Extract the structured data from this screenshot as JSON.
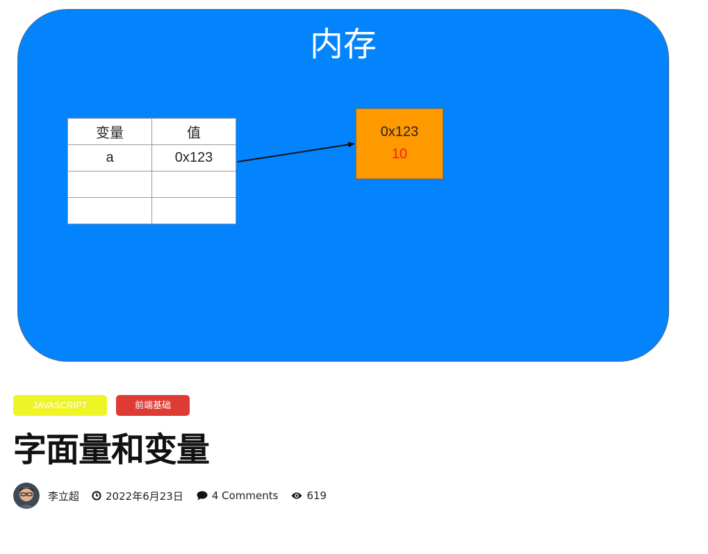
{
  "diagram": {
    "title": "内存",
    "table": {
      "headers": [
        "变量",
        "值"
      ],
      "rows": [
        [
          "a",
          "0x123"
        ],
        [
          "",
          ""
        ],
        [
          "",
          ""
        ]
      ]
    },
    "memory_box": {
      "address": "0x123",
      "value": "10"
    },
    "colors": {
      "background": "#0384fd",
      "memory_box": "#ff9900",
      "value_text": "#ff1a1a"
    }
  },
  "post": {
    "categories": [
      {
        "label": "JAVASCRIPT",
        "color": "#eef426"
      },
      {
        "label": "前端基础",
        "color": "#dd3b33"
      }
    ],
    "title": "字面量和变量",
    "meta": {
      "author": "李立超",
      "date": "2022年6月23日",
      "comments": "4 Comments",
      "views": "619"
    },
    "icons": [
      "avatar",
      "clock-icon",
      "comment-icon",
      "eye-icon"
    ]
  }
}
